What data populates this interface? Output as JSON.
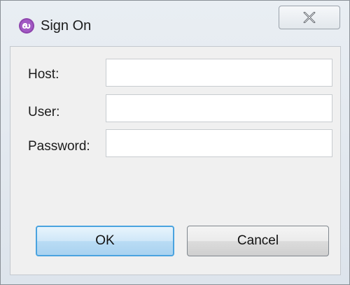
{
  "window": {
    "title": "Sign On",
    "app_icon": "app-logo-icon",
    "close_icon": "close-icon"
  },
  "form": {
    "host_label": "Host:",
    "host_value": "",
    "user_label": "User:",
    "user_value": "",
    "password_label": "Password:",
    "password_value": ""
  },
  "buttons": {
    "ok_label": "OK",
    "cancel_label": "Cancel"
  },
  "colors": {
    "accent": "#4aa3df",
    "app_icon": "#8e44ad"
  }
}
